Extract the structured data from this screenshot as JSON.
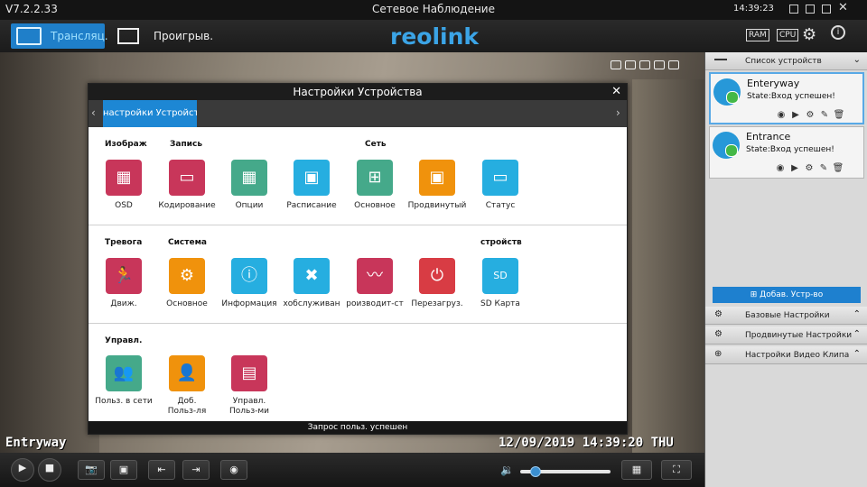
{
  "window": {
    "version": "V7.2.2.33",
    "title": "Сетевое Наблюдение",
    "clock": "14:39:23"
  },
  "toolbar": {
    "tab_live": "Трансляц.",
    "tab_playback": "Проигрыв.",
    "logo": "reolink",
    "ram_label": "RAM",
    "cpu_label": "CPU"
  },
  "video": {
    "osd_name": "Entryway",
    "osd_time": "12/09/2019 14:39:20 THU"
  },
  "dialog": {
    "title": "Настройки Устройства",
    "active_tab": "настройки Устройства",
    "status": "Запрос польз. успешен",
    "groups": {
      "image": "Изображ",
      "record": "Запись",
      "network": "Сеть",
      "alarm": "Тревога",
      "system": "Система",
      "storage": "стройств",
      "manage": "Управл."
    },
    "tiles": {
      "osd": "OSD",
      "encoding": "Кодирование",
      "options": "Опции",
      "schedule": "Расписание",
      "net_basic": "Основное",
      "advanced": "Продвинутый",
      "status": "Статус",
      "motion": "Движ.",
      "sys_basic": "Основное",
      "info": "Информация",
      "maintenance": "хобслуживан",
      "performance": "роизводит-ст",
      "reboot": "Перезагруз.",
      "sdcard": "SD Карта",
      "online_users": "Польз. в сети",
      "add_user_1": "Доб.",
      "add_user_2": "Польз-ля",
      "manage_users_1": "Управл.",
      "manage_users_2": "Польз-ми"
    }
  },
  "rightpanel": {
    "device_list_header": "Список устройств",
    "devices": [
      {
        "name": "Enteryway",
        "state": "State:Вход успешен!"
      },
      {
        "name": "Entrance",
        "state": "State:Вход успешен!"
      }
    ],
    "add_device": "Добав. Устр-во",
    "basic_settings": "Базовые Настройки",
    "advanced_settings": "Продвинутые Настройки",
    "video_clip_settings": "Настройки Видео Клипа"
  },
  "colors": {
    "accent_blue": "#1d87d4",
    "tile_crimson": "#c8365a",
    "tile_green": "#45a98a",
    "tile_cyan": "#26aee0",
    "tile_orange": "#f0920c",
    "tile_red": "#d83c44"
  }
}
